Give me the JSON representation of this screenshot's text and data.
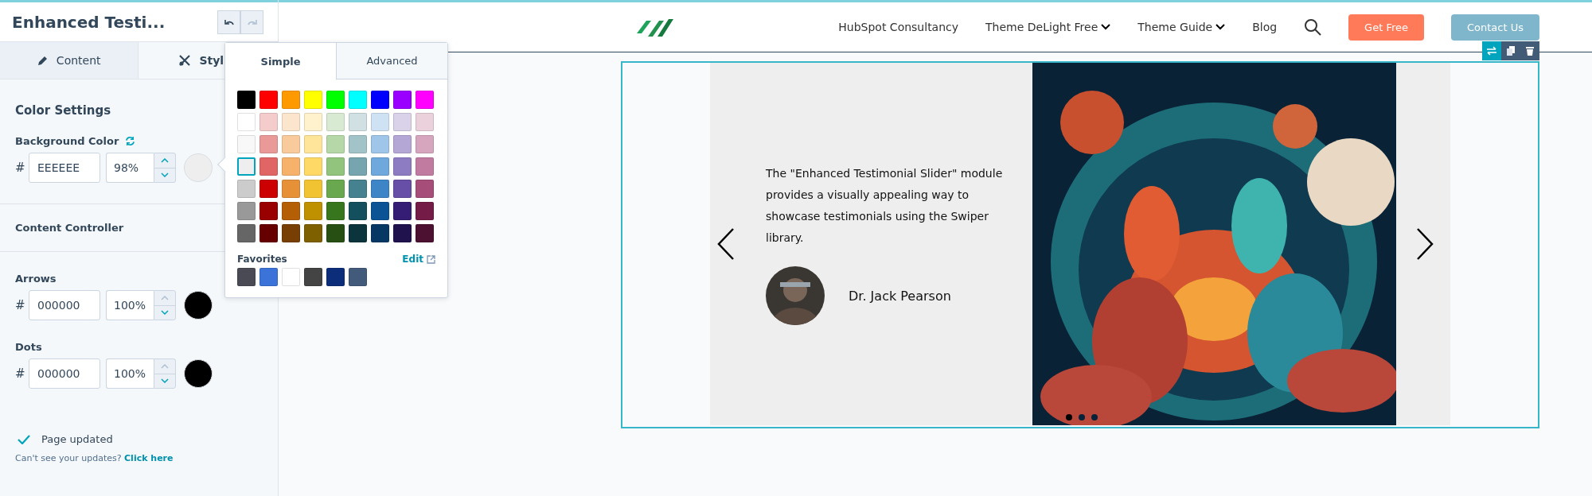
{
  "editor": {
    "title": "Enhanced Testi...",
    "undo": {
      "disabled": false
    },
    "redo": {
      "disabled": true
    }
  },
  "tabs": [
    {
      "label": "Content",
      "kind": "pencil",
      "selected": false
    },
    {
      "label": "Styl",
      "kind": "brush",
      "selected": true
    }
  ],
  "color_settings": {
    "title": "Color Settings",
    "fields": [
      {
        "label": "Background Color",
        "reset_icon": true,
        "prefix": "#",
        "hex": "EEEEEE",
        "opacity": "98%",
        "color": "#eeeeee",
        "up_disabled": false
      }
    ]
  },
  "content_controller": {
    "title": "Content Controller",
    "fields": [
      {
        "label": "Arrows",
        "reset_icon": false,
        "prefix": "#",
        "hex": "000000",
        "opacity": "100%",
        "color": "#000000",
        "up_disabled": true
      },
      {
        "label": "Dots",
        "reset_icon": false,
        "prefix": "#",
        "hex": "000000",
        "opacity": "100%",
        "color": "#000000",
        "up_disabled": true
      }
    ]
  },
  "status": {
    "text": "Page updated"
  },
  "hint": {
    "text": "Can't see your updates?",
    "link": "Click here"
  },
  "picker": {
    "tabs": [
      {
        "label": "Simple",
        "selected": true
      },
      {
        "label": "Advanced",
        "selected": false
      }
    ],
    "swatches": [
      [
        {
          "color": "#000000",
          "selected": false
        },
        {
          "color": "#ff0000",
          "selected": false
        },
        {
          "color": "#ff9900",
          "selected": false
        },
        {
          "color": "#ffff00",
          "selected": false
        },
        {
          "color": "#00ff00",
          "selected": false
        },
        {
          "color": "#00ffff",
          "selected": false
        },
        {
          "color": "#0000ff",
          "selected": false
        },
        {
          "color": "#9900ff",
          "selected": false
        },
        {
          "color": "#ff00ff",
          "selected": false
        }
      ],
      [
        {
          "color": "#ffffff",
          "selected": false
        },
        {
          "color": "#f4cccc",
          "selected": false
        },
        {
          "color": "#fce5cd",
          "selected": false
        },
        {
          "color": "#fff2cc",
          "selected": false
        },
        {
          "color": "#d9ead3",
          "selected": false
        },
        {
          "color": "#d0e0e3",
          "selected": false
        },
        {
          "color": "#cfe2f3",
          "selected": false
        },
        {
          "color": "#d9d2e9",
          "selected": false
        },
        {
          "color": "#ead1dc",
          "selected": false
        }
      ],
      [
        {
          "color": "#f8f8f8",
          "selected": false
        },
        {
          "color": "#ea9999",
          "selected": false
        },
        {
          "color": "#f9cb9c",
          "selected": false
        },
        {
          "color": "#ffe599",
          "selected": false
        },
        {
          "color": "#b6d7a8",
          "selected": false
        },
        {
          "color": "#a2c4c9",
          "selected": false
        },
        {
          "color": "#9fc5e8",
          "selected": false
        },
        {
          "color": "#b4a7d6",
          "selected": false
        },
        {
          "color": "#d5a6bd",
          "selected": false
        }
      ],
      [
        {
          "color": "#eeeeee",
          "selected": true
        },
        {
          "color": "#e06666",
          "selected": false
        },
        {
          "color": "#f6b26b",
          "selected": false
        },
        {
          "color": "#ffd966",
          "selected": false
        },
        {
          "color": "#93c47d",
          "selected": false
        },
        {
          "color": "#76a5af",
          "selected": false
        },
        {
          "color": "#6fa8dc",
          "selected": false
        },
        {
          "color": "#8e7cc3",
          "selected": false
        },
        {
          "color": "#c27ba0",
          "selected": false
        }
      ],
      [
        {
          "color": "#cccccc",
          "selected": false
        },
        {
          "color": "#cc0000",
          "selected": false
        },
        {
          "color": "#e69138",
          "selected": false
        },
        {
          "color": "#f1c232",
          "selected": false
        },
        {
          "color": "#6aa84f",
          "selected": false
        },
        {
          "color": "#45818e",
          "selected": false
        },
        {
          "color": "#3d85c6",
          "selected": false
        },
        {
          "color": "#674ea7",
          "selected": false
        },
        {
          "color": "#a64d79",
          "selected": false
        }
      ],
      [
        {
          "color": "#999999",
          "selected": false
        },
        {
          "color": "#990000",
          "selected": false
        },
        {
          "color": "#b45f06",
          "selected": false
        },
        {
          "color": "#bf9000",
          "selected": false
        },
        {
          "color": "#38761d",
          "selected": false
        },
        {
          "color": "#134f5c",
          "selected": false
        },
        {
          "color": "#0b5394",
          "selected": false
        },
        {
          "color": "#351c75",
          "selected": false
        },
        {
          "color": "#741b47",
          "selected": false
        }
      ],
      [
        {
          "color": "#666666",
          "selected": false
        },
        {
          "color": "#660000",
          "selected": false
        },
        {
          "color": "#783f04",
          "selected": false
        },
        {
          "color": "#7f6000",
          "selected": false
        },
        {
          "color": "#274e13",
          "selected": false
        },
        {
          "color": "#0c343d",
          "selected": false
        },
        {
          "color": "#073763",
          "selected": false
        },
        {
          "color": "#20124d",
          "selected": false
        },
        {
          "color": "#4c1130",
          "selected": false
        }
      ]
    ],
    "favorites_label": "Favorites",
    "edit_link": "Edit",
    "favorites": [
      {
        "color": "#4a4a55"
      },
      {
        "color": "#3b73d9"
      },
      {
        "color": "#ffffff"
      },
      {
        "color": "#444444"
      },
      {
        "color": "#0c2e7a"
      },
      {
        "color": "#425b7a"
      }
    ]
  },
  "nav": {
    "links": [
      {
        "label": "HubSpot Consultancy",
        "dropdown": false
      },
      {
        "label": "Theme DeLight Free",
        "dropdown": true
      },
      {
        "label": "Theme Guide",
        "dropdown": true
      },
      {
        "label": "Blog",
        "dropdown": false
      }
    ],
    "buttons": [
      {
        "label": "Get Free",
        "color": "#ff7a59"
      },
      {
        "label": "Contact Us",
        "color": "#7fb6cc"
      }
    ]
  },
  "slide": {
    "quote": "The \"Enhanced Testimonial Slider\" module provides a visually appealing way to showcase testimonials using the Swiper library.",
    "author": "Dr. Jack Pearson",
    "dots": [
      {
        "selected": true
      },
      {
        "selected": false
      },
      {
        "selected": false
      }
    ]
  }
}
